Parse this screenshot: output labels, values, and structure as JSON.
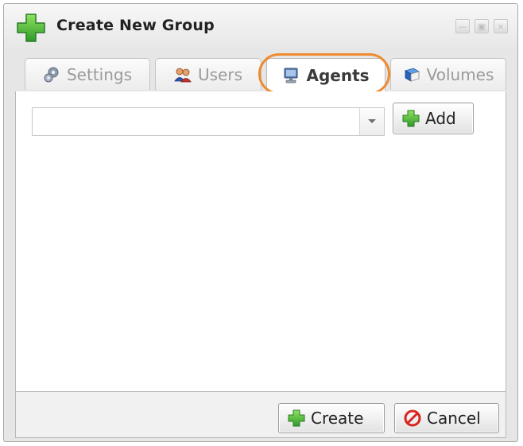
{
  "window": {
    "title": "Create New Group",
    "title_icon": "green-plus-icon"
  },
  "tabs": [
    {
      "label": "Settings",
      "icon": "gears-icon",
      "active": false
    },
    {
      "label": "Users",
      "icon": "users-icon",
      "active": false
    },
    {
      "label": "Agents",
      "icon": "computer-icon",
      "active": true
    },
    {
      "label": "Volumes",
      "icon": "book-icon",
      "active": false
    }
  ],
  "agents_panel": {
    "combo_value": "",
    "add_label": "Add"
  },
  "footer": {
    "create_label": "Create",
    "cancel_label": "Cancel"
  },
  "colors": {
    "highlight_ring": "#ef8a2e",
    "plus_green": "#3fb23a",
    "cancel_red": "#d7261e"
  }
}
